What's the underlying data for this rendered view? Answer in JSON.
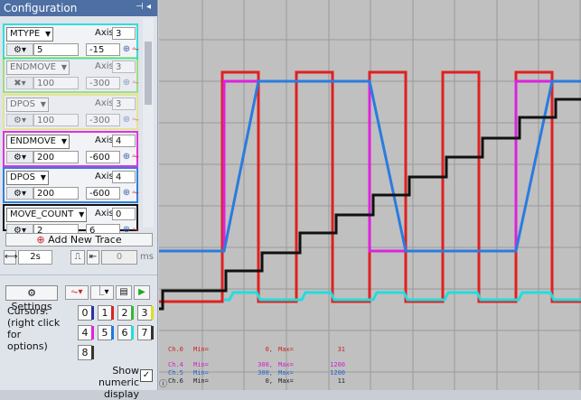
{
  "panel": {
    "title": "Configuration",
    "pin_icon": "pin-icon",
    "close_icon": "close-icon"
  },
  "traces": [
    {
      "param": "MTYPE",
      "axis_label": "Axis",
      "axis": "3",
      "value1": "5",
      "value2": "-15",
      "color": "#33dddd"
    },
    {
      "param": "ENDMOVE",
      "axis_label": "Axis",
      "axis": "3",
      "value1": "100",
      "value2": "-300",
      "color": "#66dd33"
    },
    {
      "param": "DPOS",
      "axis_label": "Axis",
      "axis": "3",
      "value1": "100",
      "value2": "-300",
      "color": "#e6e64d"
    },
    {
      "param": "ENDMOVE",
      "axis_label": "Axis",
      "axis": "4",
      "value1": "200",
      "value2": "-600",
      "color": "#dd33dd"
    },
    {
      "param": "DPOS",
      "axis_label": "Axis",
      "axis": "4",
      "value1": "200",
      "value2": "-600",
      "color": "#2f7fdf"
    },
    {
      "param": "MOVE_COUNT",
      "axis_label": "Axis",
      "axis": "0",
      "value1": "2",
      "value2": "6",
      "color": "#111111"
    }
  ],
  "add_trace_label": "Add New Trace",
  "timebase": {
    "value": "2s",
    "trigger_value": "0",
    "unit": "ms"
  },
  "settings_label": "Settings",
  "cursors": {
    "label": "Cursors:\n(right click\nfor options)",
    "buttons": [
      {
        "label": "0",
        "color": "#2233aa"
      },
      {
        "label": "1",
        "color": "#dd2222"
      },
      {
        "label": "2",
        "color": "#2bbd2b"
      },
      {
        "label": "3",
        "color": "#dddd22"
      },
      {
        "label": "4",
        "color": "#dd22dd"
      },
      {
        "label": "5",
        "color": "#2277dd"
      },
      {
        "label": "6",
        "color": "#22dddd"
      },
      {
        "label": "7",
        "color": "#333333"
      },
      {
        "label": "8",
        "color": "#333333"
      }
    ]
  },
  "show_numeric": {
    "label": "Show numeric display",
    "checked": true,
    "check_glyph": "✓"
  },
  "legend": [
    {
      "ch": "Ch.0",
      "min_label": "Min=",
      "min": "0,",
      "max_label": "Max=",
      "max": "31",
      "color": "#cc2222"
    },
    {
      "ch": "Ch.4",
      "min_label": "Min=",
      "min": "300,",
      "max_label": "Max=",
      "max": "1200",
      "color": "#cc22cc"
    },
    {
      "ch": "Ch.5",
      "min_label": "Min=",
      "min": "300,",
      "max_label": "Max=",
      "max": "1200",
      "color": "#2266cc"
    },
    {
      "ch": "Ch.6",
      "min_label": "Min=",
      "min": "0,",
      "max_label": "Max=",
      "max": "11",
      "color": "#222222"
    }
  ],
  "chart_data": {
    "type": "line",
    "grid": true,
    "series": [
      {
        "color": "#e02020",
        "values": [
          0,
          0,
          1,
          1,
          0,
          0,
          1,
          1,
          0,
          0,
          1,
          1,
          0,
          0,
          1,
          1,
          0,
          0,
          1,
          1,
          0,
          0,
          1,
          1,
          0,
          0
        ]
      },
      {
        "color": "#22dddd",
        "values": [
          0,
          0,
          0.25,
          0.25,
          0,
          0,
          0.25,
          0.25,
          0,
          0,
          0.25,
          0.25,
          0,
          0,
          0.25,
          0.25,
          0,
          0
        ]
      },
      {
        "color": "#dd22dd",
        "values": [
          0,
          1,
          1,
          1,
          0,
          0,
          1,
          1
        ]
      },
      {
        "color": "#2a7be0",
        "values": [
          0,
          0,
          1,
          1,
          0,
          0,
          1,
          1
        ]
      },
      {
        "color": "#111111",
        "values": [
          0,
          1,
          2,
          3,
          4,
          5,
          6,
          7,
          8,
          9,
          10,
          11
        ]
      }
    ]
  }
}
